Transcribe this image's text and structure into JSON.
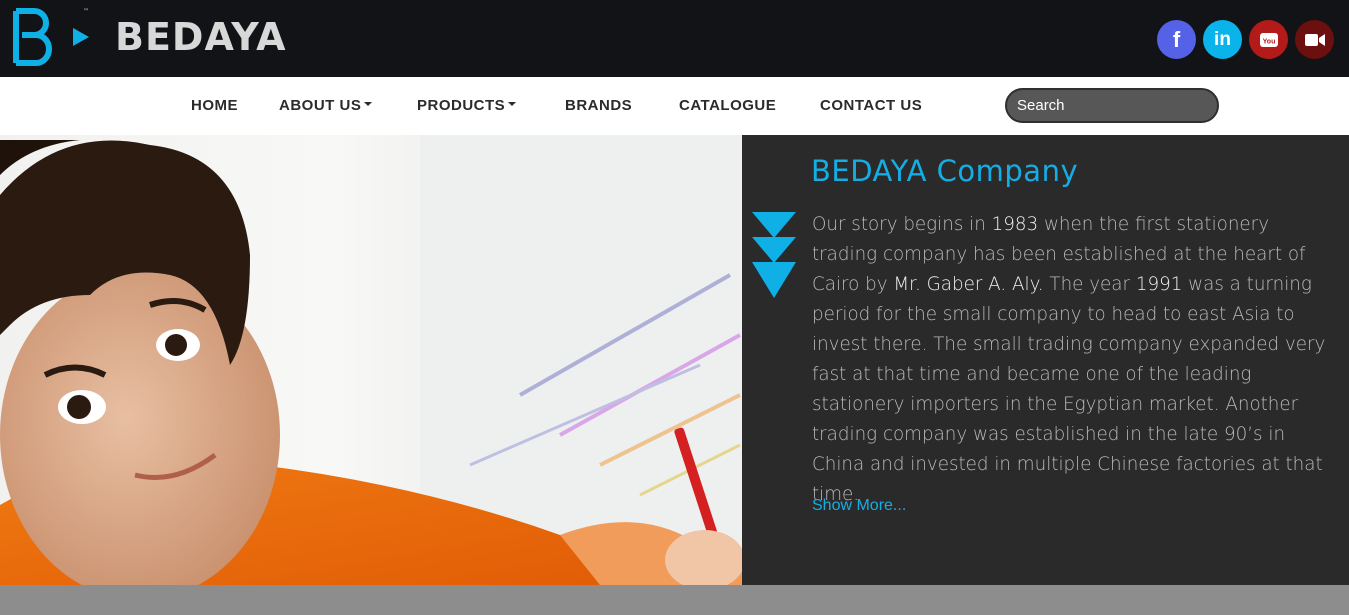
{
  "brand": {
    "name": "BEDAYA",
    "tm": "™"
  },
  "social": [
    {
      "name": "facebook-icon",
      "glyph": "f",
      "color": "#5561e6"
    },
    {
      "name": "linkedin-icon",
      "glyph": "in",
      "color": "#0ab3e9"
    },
    {
      "name": "youtube-icon",
      "glyph": "You",
      "color": "#b31b1b"
    },
    {
      "name": "video-camera-icon",
      "glyph": "",
      "color": "#6b0f0f"
    }
  ],
  "nav": {
    "home": "HOME",
    "about": "ABOUT US",
    "products": "PRODUCTS",
    "brands": "BRANDS",
    "catalogue": "CATALOGUE",
    "contact": "CONTACT US"
  },
  "search": {
    "placeholder": "Search"
  },
  "about": {
    "title": "BEDAYA Company",
    "p1": "Our story begins in ",
    "y1983": "1983",
    "p2": " when the first stationery trading company has been established at the heart of Cairo by ",
    "founder": "Mr. Gaber A. Aly.",
    "p3": " The year ",
    "y1991": "1991",
    "p4": " was a turning period for the small company to head to east Asia to invest there. The small trading company expanded very fast at that time and became one of the leading stationery importers in the Egyptian market. Another trading company was established in the late 90’s in China and invested in multiple Chinese factories at that time.",
    "show_more": "Show More..."
  },
  "colors": {
    "accent": "#14aee5",
    "topbar": "#121316",
    "panel": "#2a2a2a"
  }
}
